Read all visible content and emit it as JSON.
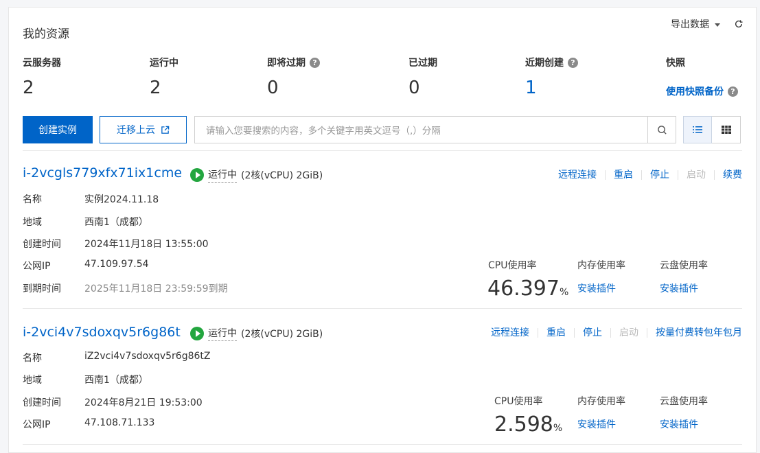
{
  "header": {
    "title": "我的资源",
    "export_label": "导出数据"
  },
  "stats": [
    {
      "label": "云服务器",
      "value": "2"
    },
    {
      "label": "运行中",
      "value": "2"
    },
    {
      "label": "即将过期",
      "value": "0"
    },
    {
      "label": "已过期",
      "value": "0"
    },
    {
      "label": "近期创建",
      "value": "1"
    },
    {
      "label": "快照",
      "link": "使用快照备份"
    }
  ],
  "toolbar": {
    "create_label": "创建实例",
    "migrate_label": "迁移上云",
    "search_placeholder": "请输入您要搜索的内容，多个关键字用英文逗号（,）分隔"
  },
  "instances": [
    {
      "id": "i-2vcgls779xfx71ix1cme",
      "status": "运行中",
      "spec": "(2核(vCPU) 2GiB)",
      "actions": [
        "远程连接",
        "重启",
        "停止",
        "启动",
        "续费"
      ],
      "fields": [
        {
          "k": "名称",
          "v": "实例2024.11.18"
        },
        {
          "k": "地域",
          "v": "西南1（成都）"
        },
        {
          "k": "创建时间",
          "v": "2024年11月18日 13:55:00"
        },
        {
          "k": "公网IP",
          "v": "47.109.97.54"
        },
        {
          "k": "到期时间",
          "v": "2025年11月18日 23:59:59到期"
        }
      ],
      "cpu_label": "CPU使用率",
      "cpu_value": "46.397",
      "mem_label": "内存使用率",
      "disk_label": "云盘使用率",
      "install_label": "安装插件"
    },
    {
      "id": "i-2vci4v7sdoxqv5r6g86t",
      "status": "运行中",
      "spec": "(2核(vCPU) 2GiB)",
      "actions": [
        "远程连接",
        "重启",
        "停止",
        "启动",
        "按量付费转包年包月"
      ],
      "fields": [
        {
          "k": "名称",
          "v": "iZ2vci4v7sdoxqv5r6g86tZ"
        },
        {
          "k": "地域",
          "v": "西南1（成都）"
        },
        {
          "k": "创建时间",
          "v": "2024年8月21日 19:53:00"
        },
        {
          "k": "公网IP",
          "v": "47.108.71.133"
        }
      ],
      "cpu_label": "CPU使用率",
      "cpu_value": "2.598",
      "mem_label": "内存使用率",
      "disk_label": "云盘使用率",
      "install_label": "安装插件"
    }
  ],
  "percent_sign": "%",
  "colors": {
    "primary": "#0064c8",
    "running": "#23a63f"
  }
}
